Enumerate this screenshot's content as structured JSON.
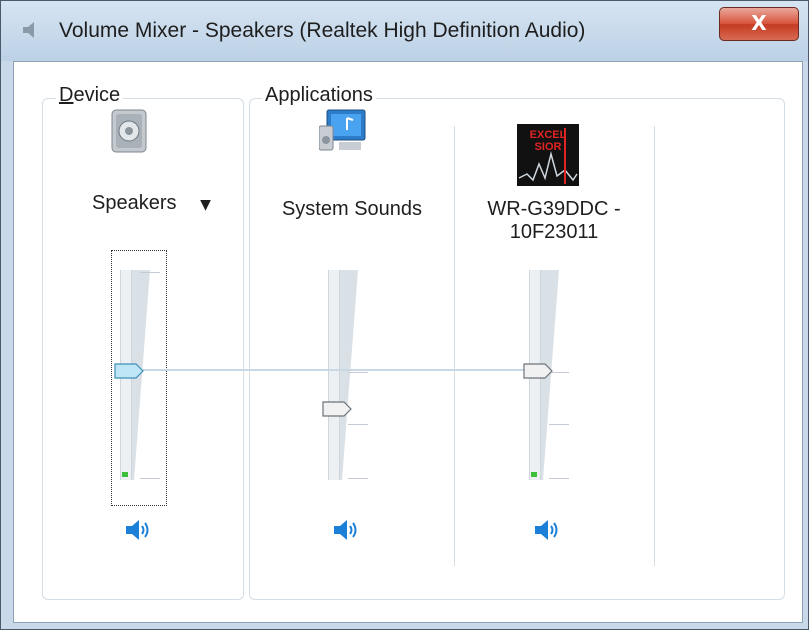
{
  "window": {
    "title": "Volume Mixer - Speakers (Realtek High Definition Audio)",
    "close_label": "X"
  },
  "device": {
    "group_label_underlined": "D",
    "group_label_rest": "evice",
    "name": "Speakers",
    "dropdown_arrow": "▼",
    "icon": "speaker-device-icon",
    "volume_level": 0.52,
    "meter_level": 0.0
  },
  "applications": {
    "group_label": "Applications",
    "items": [
      {
        "name": "System Sounds",
        "icon": "system-sounds-icon",
        "volume_level": 0.34,
        "meter_level": 0.0
      },
      {
        "name_line1": "WR-G39DDC -",
        "name_line2": "10F23011",
        "icon": "excelsior-app-icon",
        "volume_level": 0.52,
        "meter_level": 0.0
      }
    ]
  },
  "colors": {
    "titlebar": "#c9d9ea",
    "close_button": "#d9563f",
    "thumb_active": "#bfe6f7",
    "speaker_blue": "#1c7fd8",
    "meter_green": "#3cc03c"
  }
}
